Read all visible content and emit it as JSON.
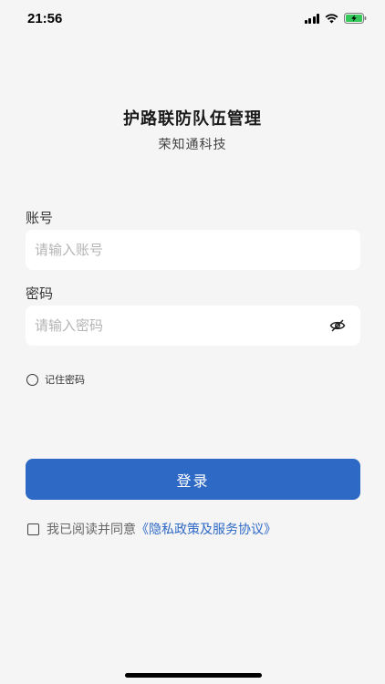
{
  "status_bar": {
    "time": "21:56"
  },
  "header": {
    "title": "护路联防队伍管理",
    "subtitle": "荣知通科技"
  },
  "account": {
    "label": "账号",
    "placeholder": "请输入账号"
  },
  "password": {
    "label": "密码",
    "placeholder": "请输入密码"
  },
  "remember": {
    "label": "记住密码"
  },
  "login": {
    "button_label": "登录"
  },
  "agreement": {
    "text": "我已阅读并同意",
    "link": "《隐私政策及服务协议》"
  },
  "colors": {
    "primary": "#2f69c6",
    "background": "#f5f5f5"
  },
  "icons": {
    "password_toggle": "eye-off-icon"
  }
}
